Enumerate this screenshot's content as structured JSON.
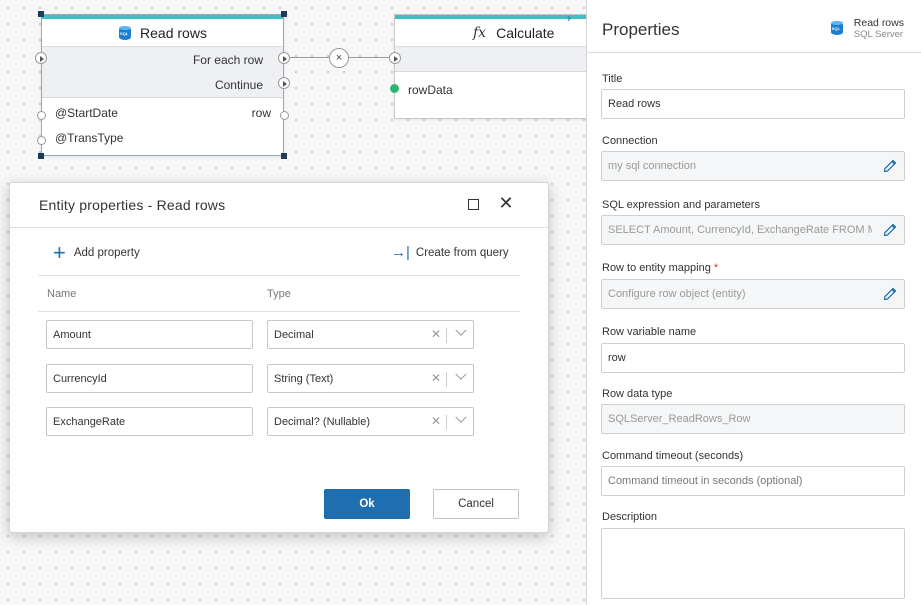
{
  "canvas": {
    "read_node": {
      "title": "Read rows",
      "outputs": [
        "For each row",
        "Continue"
      ],
      "params": [
        {
          "name": "@StartDate",
          "output": "row"
        },
        {
          "name": "@TransType",
          "output": ""
        }
      ]
    },
    "connector_glyph": "×",
    "calc_node": {
      "fx": "fx",
      "title": "Calculate",
      "inputs": [
        "rowData"
      ]
    },
    "collapse_glyph": "›"
  },
  "dialog": {
    "title": "Entity properties - Read rows",
    "add_property": "Add property",
    "create_from_query": "Create from query",
    "columns": {
      "name": "Name",
      "type": "Type"
    },
    "rows": [
      {
        "name": "Amount",
        "type": "Decimal"
      },
      {
        "name": "CurrencyId",
        "type": "String (Text)"
      },
      {
        "name": "ExchangeRate",
        "type": "Decimal? (Nullable)"
      }
    ],
    "ok": "Ok",
    "cancel": "Cancel"
  },
  "panel": {
    "title": "Properties",
    "context_name": "Read rows",
    "context_sub": "SQL Server",
    "fields": {
      "title": {
        "label": "Title",
        "value": "Read rows"
      },
      "connection": {
        "label": "Connection",
        "value": "my sql connection"
      },
      "sql": {
        "label": "SQL expression and parameters",
        "value": "SELECT Amount, CurrencyId, ExchangeRate FROM My..."
      },
      "mapping": {
        "label": "Row to entity mapping",
        "required": "*",
        "value": "Configure row object (entity)"
      },
      "row_var": {
        "label": "Row variable name",
        "value": "row"
      },
      "row_type": {
        "label": "Row data type",
        "value": "SQLServer_ReadRows_Row"
      },
      "timeout": {
        "label": "Command timeout (seconds)",
        "placeholder": "Command timeout in seconds (optional)"
      },
      "description": {
        "label": "Description",
        "value": ""
      }
    }
  },
  "colors": {
    "accent": "#1f6fb0",
    "node_bar": "#3fbfc0",
    "port_active": "#2bb673"
  }
}
